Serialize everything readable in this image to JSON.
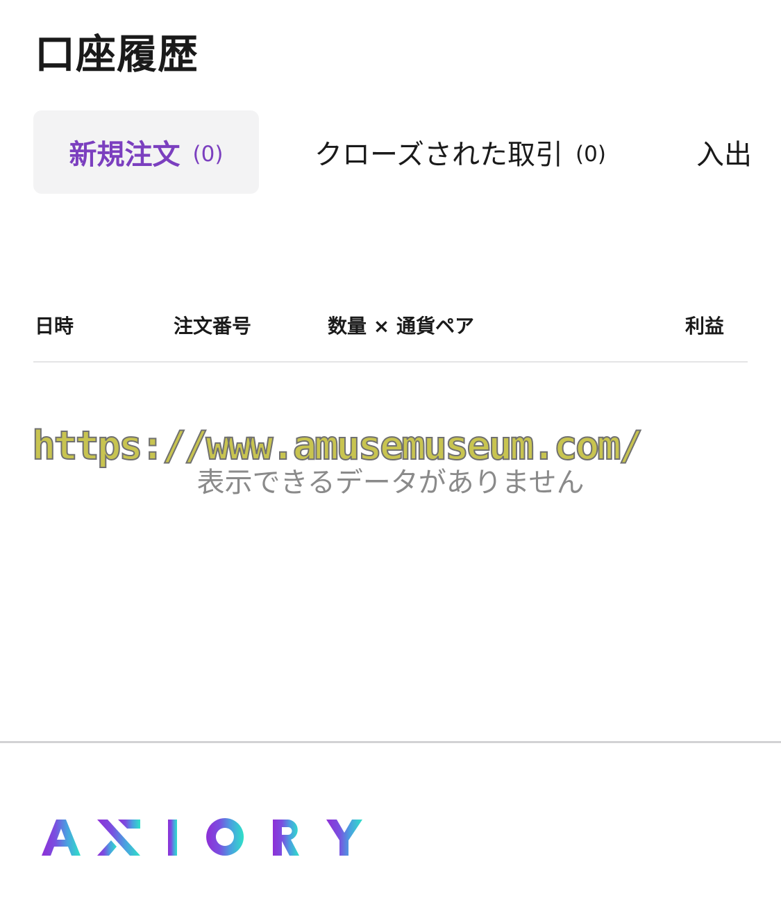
{
  "header": {
    "title": "口座履歴"
  },
  "tabs": [
    {
      "label": "新規注文",
      "count": "(0)",
      "active": true
    },
    {
      "label": "クローズされた取引",
      "count": "(0)",
      "active": false
    },
    {
      "label": "入出",
      "count": "",
      "active": false
    }
  ],
  "table": {
    "columns": [
      "日時",
      "注文番号",
      "数量 × 通貨ペア",
      "利益"
    ],
    "empty_message": "表示できるデータがありません"
  },
  "watermark": "https://www.amusemuseum.com/",
  "footer": {
    "logo_text": "AXIORY",
    "logo_gradient": [
      "#8e2fd6",
      "#2fe0c8"
    ]
  },
  "colors": {
    "accent": "#7b3fbf",
    "active_tab_bg": "#f3f3f4",
    "divider": "#d2d2d4"
  }
}
